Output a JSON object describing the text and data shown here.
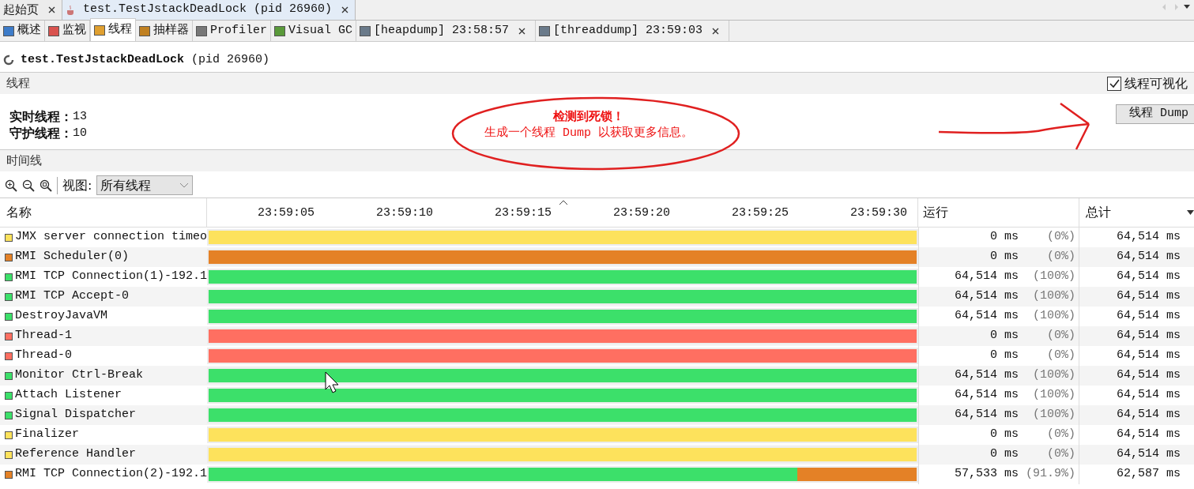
{
  "document_tabs": [
    {
      "label": "起始页",
      "selected": false,
      "kind": "plain"
    },
    {
      "label": "test.TestJstackDeadLock (pid 26960)",
      "selected": true,
      "kind": "app"
    }
  ],
  "view_tabs": [
    {
      "label": "概述",
      "selected": false,
      "closable": false
    },
    {
      "label": "监视",
      "selected": false,
      "closable": false
    },
    {
      "label": "线程",
      "selected": true,
      "closable": false
    },
    {
      "label": "抽样器",
      "selected": false,
      "closable": false
    },
    {
      "label": "Profiler",
      "selected": false,
      "closable": false
    },
    {
      "label": "Visual GC",
      "selected": false,
      "closable": false
    },
    {
      "label": "[heapdump] 23:58:57",
      "selected": false,
      "closable": true
    },
    {
      "label": "[threaddump] 23:59:03",
      "selected": false,
      "closable": true
    }
  ],
  "header": {
    "app": "test.TestJstackDeadLock",
    "pid": "(pid 26960)"
  },
  "threads_section": {
    "title": "线程",
    "visualize_checkbox": {
      "label": "线程可视化",
      "checked": true
    },
    "stats": [
      {
        "label": "实时线程：",
        "value": "13"
      },
      {
        "label": "守护线程：",
        "value": "10"
      }
    ],
    "alert": {
      "title": "检测到死锁！",
      "message": "生成一个线程 Dump 以获取更多信息。"
    },
    "dump_button": "线程 Dump"
  },
  "timeline_section": {
    "title": "时间线",
    "view_label": "视图:",
    "view_select": "所有线程"
  },
  "table": {
    "columns": [
      "名称",
      "运行",
      "总计"
    ],
    "ticks": [
      "23:59:05",
      "23:59:10",
      "23:59:15",
      "23:59:20",
      "23:59:25",
      "23:59:30"
    ],
    "rows": [
      {
        "name": "JMX server connection timeo",
        "color": "#fde25c",
        "bar": {
          "color": "#fde25c",
          "level": 1
        },
        "running": "0 ms",
        "percent": "(0%)",
        "total": "64,514 ms"
      },
      {
        "name": "RMI Scheduler(0)",
        "color": "#e48126",
        "bar": {
          "color": "#e48126",
          "level": 1
        },
        "running": "0 ms",
        "percent": "(0%)",
        "total": "64,514 ms"
      },
      {
        "name": "RMI TCP Connection(1)-192.1",
        "color": "#3ce06a",
        "bar": {
          "color": "#3ce06a",
          "level": 1
        },
        "running": "64,514 ms",
        "percent": "(100%)",
        "total": "64,514 ms"
      },
      {
        "name": "RMI TCP Accept-0",
        "color": "#3ce06a",
        "bar": {
          "color": "#3ce06a",
          "level": 1
        },
        "running": "64,514 ms",
        "percent": "(100%)",
        "total": "64,514 ms"
      },
      {
        "name": "DestroyJavaVM",
        "color": "#3ce06a",
        "bar": {
          "color": "#3ce06a",
          "level": 1
        },
        "running": "64,514 ms",
        "percent": "(100%)",
        "total": "64,514 ms"
      },
      {
        "name": "Thread-1",
        "color": "#ff6f61",
        "bar": {
          "color": "#ff6f61",
          "level": 1
        },
        "running": "0 ms",
        "percent": "(0%)",
        "total": "64,514 ms"
      },
      {
        "name": "Thread-0",
        "color": "#ff6f61",
        "bar": {
          "color": "#ff6f61",
          "level": 1
        },
        "running": "0 ms",
        "percent": "(0%)",
        "total": "64,514 ms"
      },
      {
        "name": "Monitor Ctrl-Break",
        "color": "#3ce06a",
        "bar": {
          "color": "#3ce06a",
          "level": 1
        },
        "running": "64,514 ms",
        "percent": "(100%)",
        "total": "64,514 ms"
      },
      {
        "name": "Attach Listener",
        "color": "#3ce06a",
        "bar": {
          "color": "#3ce06a",
          "level": 1
        },
        "running": "64,514 ms",
        "percent": "(100%)",
        "total": "64,514 ms"
      },
      {
        "name": "Signal Dispatcher",
        "color": "#3ce06a",
        "bar": {
          "color": "#3ce06a",
          "level": 1
        },
        "running": "64,514 ms",
        "percent": "(100%)",
        "total": "64,514 ms"
      },
      {
        "name": "Finalizer",
        "color": "#fde25c",
        "bar": {
          "color": "#fde25c",
          "level": 1
        },
        "running": "0 ms",
        "percent": "(0%)",
        "total": "64,514 ms"
      },
      {
        "name": "Reference Handler",
        "color": "#fde25c",
        "bar": {
          "color": "#fde25c",
          "level": 1
        },
        "running": "0 ms",
        "percent": "(0%)",
        "total": "64,514 ms"
      },
      {
        "name": "RMI TCP Connection(2)-192.1",
        "color": "#e48126",
        "bar": {
          "color": "#3ce06a",
          "level": 0.831,
          "rest": {
            "color": "#e48126"
          }
        },
        "running": "57,533 ms",
        "percent": "(91.9%)",
        "total": "62,587 ms"
      }
    ]
  }
}
